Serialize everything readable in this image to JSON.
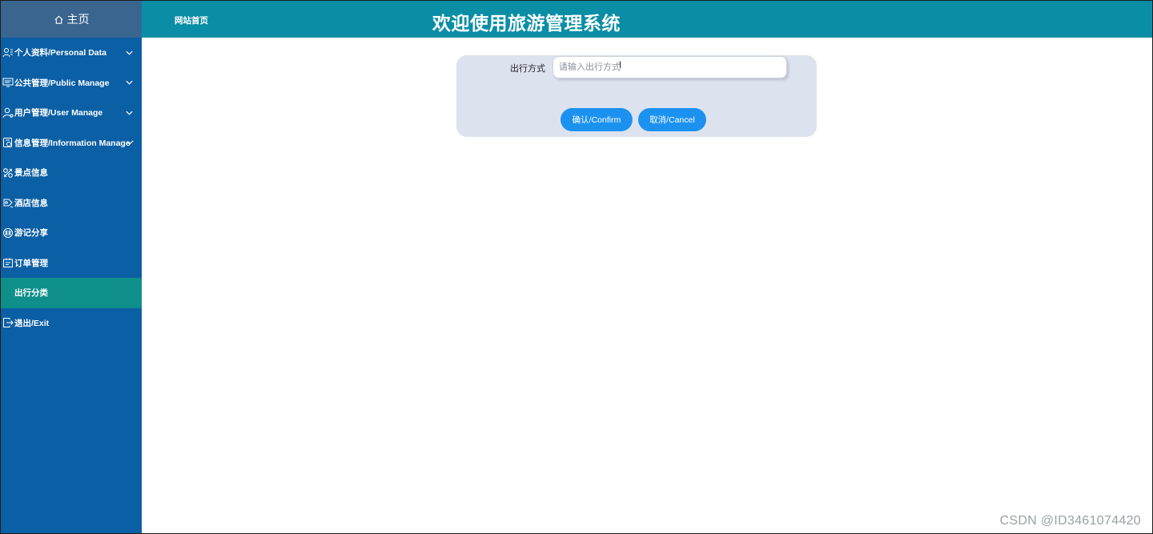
{
  "sidebar": {
    "home_label": "主页",
    "items": [
      {
        "label": "个人资料/Personal Data",
        "icon": "user-list-icon",
        "has_chevron": true
      },
      {
        "label": "公共管理/Public Manage",
        "icon": "monitor-icon",
        "has_chevron": true
      },
      {
        "label": "用户管理/User Manage",
        "icon": "user-icon",
        "has_chevron": true
      },
      {
        "label": "信息管理/Information Manage",
        "icon": "document-settings-icon",
        "has_chevron": true
      },
      {
        "label": "景点信息",
        "icon": "scenic-icon",
        "has_chevron": false
      },
      {
        "label": "酒店信息",
        "icon": "hotel-icon",
        "has_chevron": false
      },
      {
        "label": "游记分享",
        "icon": "share-icon",
        "has_chevron": false
      },
      {
        "label": "订单管理",
        "icon": "order-icon",
        "has_chevron": false
      },
      {
        "label": "出行分类",
        "icon": "",
        "active": true
      },
      {
        "label": "退出/Exit",
        "icon": "exit-icon",
        "has_chevron": false
      }
    ]
  },
  "header": {
    "breadcrumb": "网站首页",
    "title": "欢迎使用旅游管理系统"
  },
  "form": {
    "field_label": "出行方式",
    "field_value": "",
    "field_placeholder": "请输入出行方式",
    "confirm_label": "确认/Confirm",
    "cancel_label": "取消/Cancel"
  },
  "watermark": "CSDN @ID3461074420",
  "colors": {
    "sidebar_bg": "#0b5fa5",
    "home_bg": "#39658f",
    "active_item_bg": "#0e8f8a",
    "header_bg": "#0a8ea5",
    "card_bg": "#dde2ef",
    "button_bg": "#1c92f0"
  }
}
